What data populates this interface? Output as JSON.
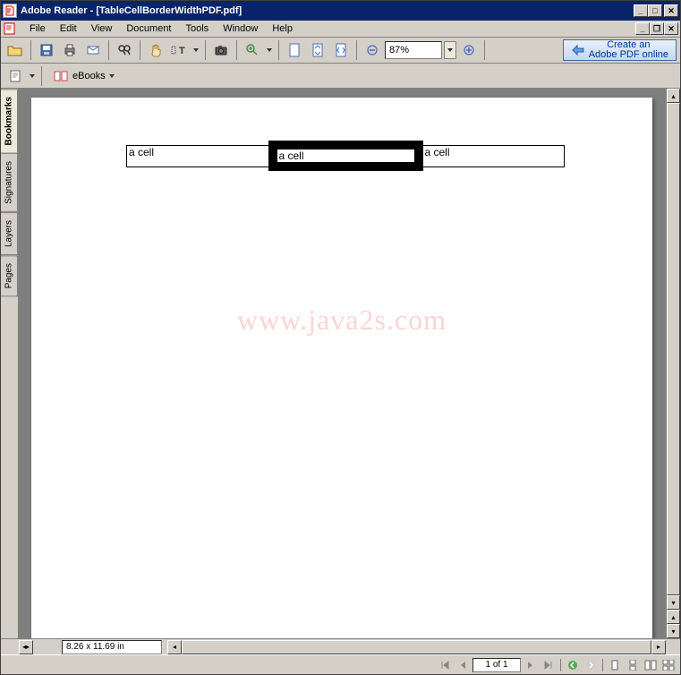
{
  "titlebar": {
    "app_name": "Adobe Reader",
    "doc_name": "[TableCellBorderWidthPDF.pdf]"
  },
  "menu": {
    "file": "File",
    "edit": "Edit",
    "view": "View",
    "document": "Document",
    "tools": "Tools",
    "window": "Window",
    "help": "Help"
  },
  "toolbar": {
    "zoom_value": "87%",
    "create_line1": "Create an",
    "create_line2": "Adobe PDF online"
  },
  "toolbar2": {
    "ebooks": "eBooks"
  },
  "sidetabs": {
    "bookmarks": "Bookmarks",
    "signatures": "Signatures",
    "layers": "Layers",
    "pages": "Pages"
  },
  "document": {
    "cell1": "a cell",
    "cell2": "a cell",
    "cell3": "a cell",
    "watermark": "www.java2s.com"
  },
  "status": {
    "dimensions": "8.26 x 11.69 in",
    "page_of": "1 of 1"
  }
}
